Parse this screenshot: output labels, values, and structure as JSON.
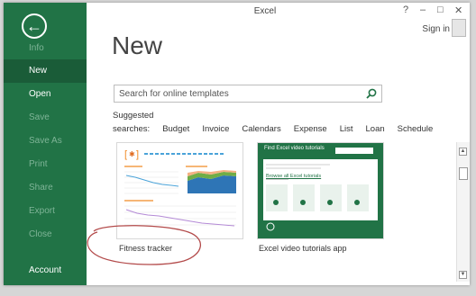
{
  "window": {
    "title": "Excel",
    "help": "?",
    "minimize": "–",
    "restore": "□",
    "close": "✕",
    "sign_in": "Sign in"
  },
  "sidebar": {
    "items": [
      {
        "label": "Info"
      },
      {
        "label": "New"
      },
      {
        "label": "Open"
      },
      {
        "label": "Save"
      },
      {
        "label": "Save As"
      },
      {
        "label": "Print"
      },
      {
        "label": "Share"
      },
      {
        "label": "Export"
      },
      {
        "label": "Close"
      },
      {
        "label": "Account"
      }
    ]
  },
  "main": {
    "heading": "New",
    "search": {
      "placeholder": "Search for online templates"
    },
    "suggested": {
      "label": "Suggested searches:",
      "terms": [
        "Budget",
        "Invoice",
        "Calendars",
        "Expense",
        "List",
        "Loan",
        "Schedule"
      ]
    },
    "templates": [
      {
        "caption": "Fitness tracker"
      },
      {
        "caption": "Excel video tutorials app"
      }
    ],
    "video_tile": {
      "header": "Find Excel video tutorials",
      "link": "Browse all Excel tutorials"
    }
  },
  "colors": {
    "sidebar": "#217346",
    "selected": "#1a5c38",
    "annotation": "#b34a4a"
  }
}
